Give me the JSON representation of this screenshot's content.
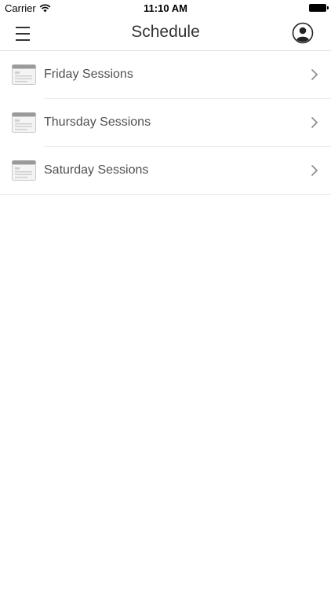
{
  "status_bar": {
    "carrier": "Carrier",
    "time": "11:10 AM"
  },
  "nav": {
    "title": "Schedule",
    "menu_icon": "hamburger-menu-icon",
    "profile_icon": "user-profile-icon"
  },
  "sessions": [
    {
      "label": "Friday Sessions",
      "icon": "calendar-icon"
    },
    {
      "label": "Thursday Sessions",
      "icon": "calendar-icon"
    },
    {
      "label": "Saturday Sessions",
      "icon": "calendar-icon"
    }
  ],
  "colors": {
    "text": "#4d5154",
    "separator": "#ececec",
    "chevron": "#8e8e93"
  }
}
